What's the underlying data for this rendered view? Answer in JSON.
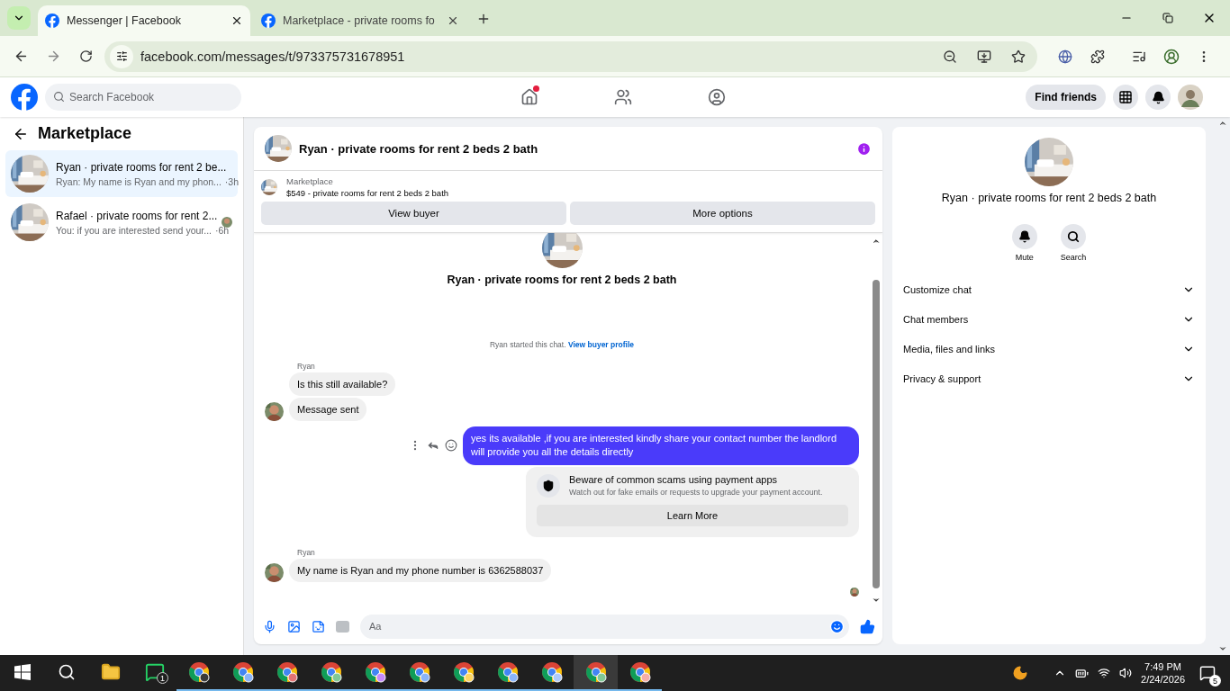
{
  "browser": {
    "tabs": [
      {
        "title": "Messenger | Facebook",
        "selected": true
      },
      {
        "title": "Marketplace - private rooms fo",
        "selected": false
      }
    ],
    "url": "facebook.com/messages/t/973375731678951"
  },
  "header": {
    "search_placeholder": "Search Facebook",
    "nav": [
      {
        "kind": "home",
        "dot": true
      },
      {
        "kind": "friends",
        "dot": false
      },
      {
        "kind": "groups",
        "dot": false
      }
    ],
    "find_friends": "Find friends"
  },
  "sidebar": {
    "title": "Marketplace",
    "conversations": [
      {
        "name": "Ryan · private rooms for rent 2 be...",
        "preview": "Ryan: My name is Ryan and my phon...",
        "time": "·3h",
        "selected": true,
        "seen": false
      },
      {
        "name": "Rafael · private rooms for rent 2...",
        "preview": "You: if you are interested send your...",
        "time": "·6h",
        "selected": false,
        "seen": true
      }
    ]
  },
  "chat": {
    "title": "Ryan · private rooms for rent 2 beds 2 bath",
    "listing": {
      "label": "Marketplace",
      "title": "$549 - private rooms for rent 2 beds 2 bath"
    },
    "buttons": [
      "View buyer",
      "More options"
    ],
    "intro": {
      "title": "Ryan · private rooms for rent 2 beds 2 bath",
      "started": "Ryan started this chat.",
      "link": "View buyer profile"
    },
    "messages": [
      {
        "kind": "incoming",
        "sender": "Ryan",
        "bubbles": [
          "Is this still available?",
          "Message sent"
        ]
      },
      {
        "kind": "outgoing",
        "hovered": true,
        "text": "yes its available ,if you are interested kindly share your contact number the landlord will provide you all the details directly"
      },
      {
        "kind": "notice",
        "title": "Beware of common scams using payment apps",
        "body": "Watch out for fake emails or requests to upgrade your payment account.",
        "button": "Learn More"
      },
      {
        "kind": "incoming",
        "sender": "Ryan",
        "bubbles": [
          "My name is Ryan and my phone number is 6362588037"
        ]
      }
    ],
    "composer_placeholder": "Aa"
  },
  "info": {
    "title": "Ryan · private rooms for rent 2 beds 2 bath",
    "actions": [
      {
        "kind": "mute",
        "label": "Mute"
      },
      {
        "kind": "search",
        "label": "Search"
      }
    ],
    "sections": [
      "Customize chat",
      "Chat members",
      "Media, files and links",
      "Privacy & support"
    ]
  },
  "taskbar": {
    "apps": [
      {
        "kind": "explorer",
        "selected": false
      },
      {
        "kind": "whatsapp",
        "badge": "1",
        "selected": false
      },
      {
        "kind": "chrome",
        "selected": false
      },
      {
        "kind": "chrome",
        "selected": false
      },
      {
        "kind": "chrome",
        "selected": false
      },
      {
        "kind": "chrome",
        "selected": false
      },
      {
        "kind": "chrome",
        "selected": false
      },
      {
        "kind": "chrome",
        "selected": false
      },
      {
        "kind": "chrome",
        "selected": false
      },
      {
        "kind": "chrome",
        "selected": false
      },
      {
        "kind": "chrome",
        "selected": false
      },
      {
        "kind": "chrome",
        "selected": true
      },
      {
        "kind": "chrome",
        "selected": false
      }
    ],
    "time": "7:49 PM",
    "date": "2/24/2026",
    "notifications": "5"
  }
}
